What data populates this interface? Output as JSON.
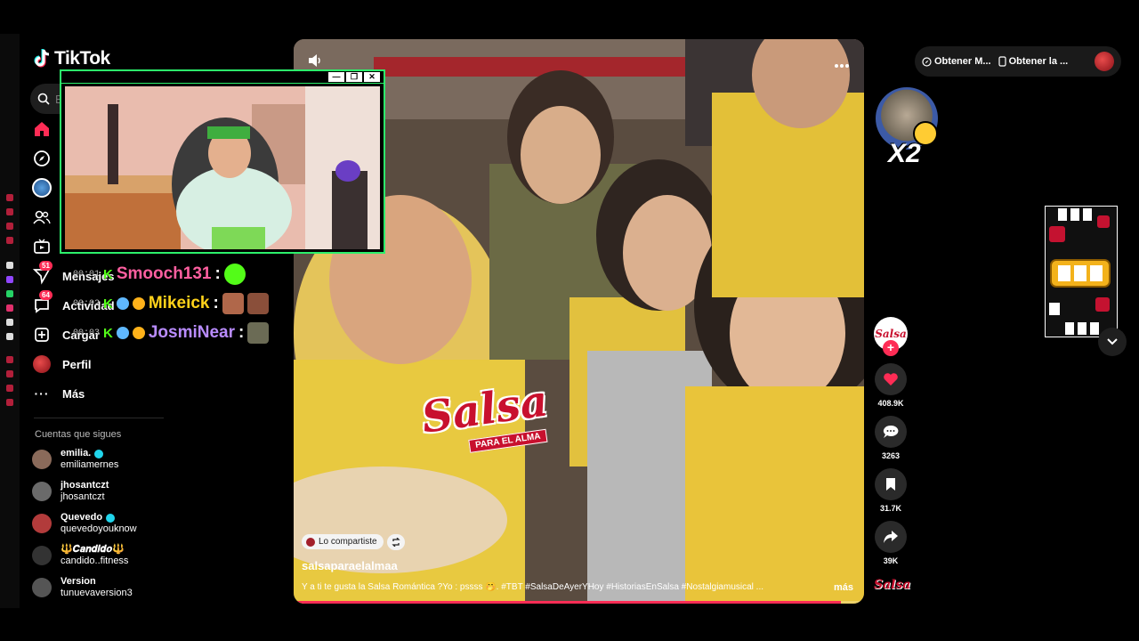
{
  "app": {
    "name": "TikTok"
  },
  "search": {
    "placeholder": "Buscar"
  },
  "nav": [
    {
      "key": "home",
      "label": ""
    },
    {
      "key": "explore",
      "label": ""
    },
    {
      "key": "live",
      "label": ""
    },
    {
      "key": "following",
      "label": ""
    },
    {
      "key": "tv",
      "label": ""
    },
    {
      "key": "messages",
      "label": "Mensajes",
      "badge": "51"
    },
    {
      "key": "activity",
      "label": "Actividad",
      "badge": "64"
    },
    {
      "key": "upload",
      "label": "Cargar"
    },
    {
      "key": "profile",
      "label": "Perfil"
    },
    {
      "key": "more",
      "label": "Más"
    }
  ],
  "following": {
    "title": "Cuentas que sigues",
    "accounts": [
      {
        "name": "emilia.",
        "handle": "emiliamernes",
        "verified": true,
        "color": "#8a6a5a"
      },
      {
        "name": "jhosantczt",
        "handle": "jhosantczt",
        "verified": false,
        "color": "#6a6a6a"
      },
      {
        "name": "Quevedo",
        "handle": "quevedoyouknow",
        "verified": true,
        "color": "#b23b3b"
      },
      {
        "name": "🔱𝑪𝒂𝒏𝒅𝒊𝒅𝒐🔱",
        "handle": "candido..fitness",
        "verified": false,
        "color": "#333333"
      },
      {
        "name": "Version",
        "handle": "tunuevaversion3",
        "verified": false,
        "color": "#555555"
      }
    ]
  },
  "chat": [
    {
      "time": "00:01",
      "badges": "K",
      "user": "Smooch131",
      "color": "#ff5fa0"
    },
    {
      "time": "00:02",
      "badges": "K",
      "user": "Mikeick",
      "color": "#ffd21a"
    },
    {
      "time": "00:03",
      "badges": "K",
      "user": "JosmiNear",
      "color": "#b98cff"
    }
  ],
  "video": {
    "shared_label": "Lo compartiste",
    "author": "salsaparaelalmaa",
    "caption": "Y a ti te gusta la Salsa Romántica ?Yo : pssss 🤭. #TBT #SalsaDeAyerYHoy #HistoriasEnSalsa #Nostalgiamusical ...",
    "more_label": "más",
    "overlay_title": "Salsa",
    "overlay_subtitle": "PARA EL ALMA",
    "progress": 0.96
  },
  "actions": {
    "likes": "408.9K",
    "comments": "3263",
    "saves": "31.7K",
    "shares": "39K",
    "creator_logo": "Salsa"
  },
  "top_right": {
    "item1": "Obtener M...",
    "item2": "Obtener la ..."
  },
  "sticker": {
    "text": "X2"
  },
  "colors": {
    "accent": "#fe2c55",
    "kick_green": "#53fc18",
    "overlay_border": "#2cf06b"
  }
}
